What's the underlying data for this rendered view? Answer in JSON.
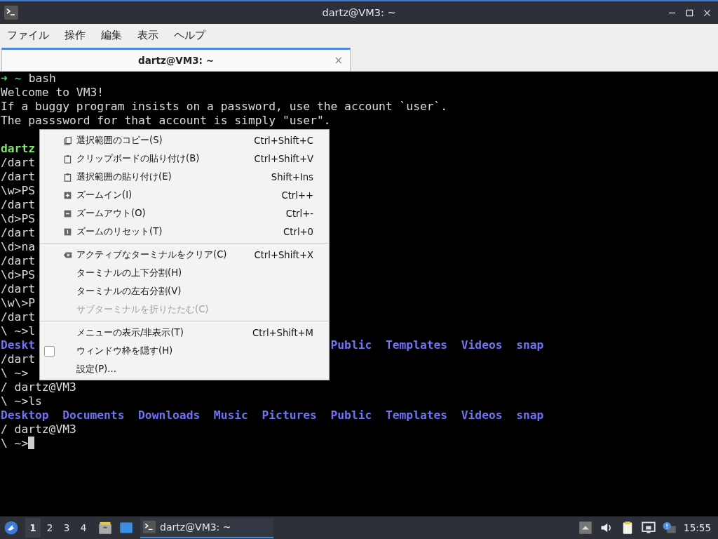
{
  "window": {
    "title": "dartz@VM3: ~"
  },
  "menubar": [
    {
      "label": "ファイル"
    },
    {
      "label": "操作"
    },
    {
      "label": "編集"
    },
    {
      "label": "表示"
    },
    {
      "label": "ヘルプ"
    }
  ],
  "tabs": [
    {
      "label": "dartz@VM3: ~",
      "selected": true,
      "close": "×"
    }
  ],
  "terminal": {
    "lines": [
      {
        "parts": [
          {
            "kind": "arrow",
            "text": "➜"
          },
          {
            "kind": "tilde",
            "text": "~"
          },
          {
            "kind": "plain",
            "text": "bash"
          }
        ]
      },
      {
        "parts": [
          {
            "kind": "plain",
            "text": "Welcome to VM3!"
          }
        ]
      },
      {
        "parts": [
          {
            "kind": "plain",
            "text": "If a buggy program insists on a password, use the account `user`."
          }
        ]
      },
      {
        "parts": [
          {
            "kind": "plain",
            "text": "The passsword for that account is simply \"user\"."
          }
        ]
      },
      {
        "kind": "blank"
      },
      {
        "parts": [
          {
            "kind": "user",
            "text": "dartz"
          }
        ]
      },
      {
        "parts": [
          {
            "kind": "plain",
            "text": "/dart"
          }
        ]
      },
      {
        "parts": [
          {
            "kind": "plain",
            "text": "/dart"
          }
        ]
      },
      {
        "parts": [
          {
            "kind": "plain",
            "text": "\\w>PS"
          }
        ]
      },
      {
        "parts": [
          {
            "kind": "plain",
            "text": "/dart"
          }
        ]
      },
      {
        "parts": [
          {
            "kind": "plain",
            "text": "\\d>PS"
          }
        ]
      },
      {
        "parts": [
          {
            "kind": "plain",
            "text": "/dart"
          }
        ]
      },
      {
        "parts": [
          {
            "kind": "plain",
            "text": "\\d>na"
          }
        ]
      },
      {
        "parts": [
          {
            "kind": "plain",
            "text": "/dart"
          }
        ]
      },
      {
        "parts": [
          {
            "kind": "plain",
            "text": "\\d>PS"
          }
        ]
      },
      {
        "parts": [
          {
            "kind": "plain",
            "text": "/dart"
          }
        ]
      },
      {
        "parts": [
          {
            "kind": "plain",
            "text": "\\w\\>P"
          }
        ]
      },
      {
        "parts": [
          {
            "kind": "plain",
            "text": "/dart"
          }
        ]
      },
      {
        "parts": [
          {
            "kind": "plain",
            "text": "\\ ~>l"
          }
        ]
      },
      {
        "parts": [
          {
            "kind": "dir",
            "text": "Deskt"
          },
          {
            "kind": "dir-tail",
            "text": "Public  Templates  Videos  snap"
          }
        ]
      },
      {
        "parts": [
          {
            "kind": "plain",
            "text": "/dart"
          }
        ]
      },
      {
        "parts": [
          {
            "kind": "plain",
            "text": "\\ ~>"
          }
        ]
      },
      {
        "parts": [
          {
            "kind": "plain",
            "text": "/ dartz@VM3"
          }
        ]
      },
      {
        "parts": [
          {
            "kind": "plain",
            "text": "\\ ~>ls"
          }
        ]
      },
      {
        "parts": [
          {
            "kind": "dir",
            "text": "Desktop  Documents  Downloads  Music  Pictures  Public  Templates  Videos  snap"
          }
        ]
      },
      {
        "parts": [
          {
            "kind": "plain",
            "text": "/ dartz@VM3"
          }
        ]
      },
      {
        "parts": [
          {
            "kind": "plain",
            "text": "\\ ~>"
          },
          {
            "kind": "cursor"
          }
        ]
      }
    ]
  },
  "context_menu": {
    "items": [
      {
        "kind": "item",
        "label": "選択範囲のコピー(S)",
        "shortcut": "Ctrl+Shift+C",
        "disabled": false
      },
      {
        "kind": "item",
        "label": "クリップボードの貼り付け(B)",
        "shortcut": "Ctrl+Shift+V",
        "disabled": false
      },
      {
        "kind": "item",
        "label": "選択範囲の貼り付け(E)",
        "shortcut": "Shift+Ins",
        "disabled": false
      },
      {
        "kind": "item",
        "label": "ズームイン(I)",
        "shortcut": "Ctrl++",
        "disabled": false
      },
      {
        "kind": "item",
        "label": "ズームアウト(O)",
        "shortcut": "Ctrl+-",
        "disabled": false
      },
      {
        "kind": "item",
        "label": "ズームのリセット(T)",
        "shortcut": "Ctrl+0",
        "disabled": false
      },
      {
        "kind": "separator"
      },
      {
        "kind": "item",
        "label": "アクティブなターミナルをクリア(C)",
        "shortcut": "Ctrl+Shift+X",
        "disabled": false
      },
      {
        "kind": "item",
        "label": "ターミナルの上下分割(H)",
        "disabled": false
      },
      {
        "kind": "item",
        "label": "ターミナルの左右分割(V)",
        "disabled": false
      },
      {
        "kind": "item",
        "label": "サブターミナルを折りたたむ(C)",
        "disabled": true
      },
      {
        "kind": "separator"
      },
      {
        "kind": "item",
        "label": "メニューの表示/非表示(T)",
        "shortcut": "Ctrl+Shift+M",
        "disabled": false
      },
      {
        "kind": "check",
        "label": "ウィンドウ枠を隠す(H)",
        "checked": false,
        "disabled": false
      },
      {
        "kind": "item",
        "label": "設定(P)...",
        "disabled": false
      }
    ]
  },
  "taskbar": {
    "workspaces": [
      {
        "label": "1",
        "selected": true
      },
      {
        "label": "2",
        "selected": false
      },
      {
        "label": "3",
        "selected": false
      },
      {
        "label": "4",
        "selected": false
      }
    ],
    "tasks": [
      {
        "label": "dartz@VM3: ~",
        "selected": true
      }
    ],
    "clock": "15:55"
  }
}
